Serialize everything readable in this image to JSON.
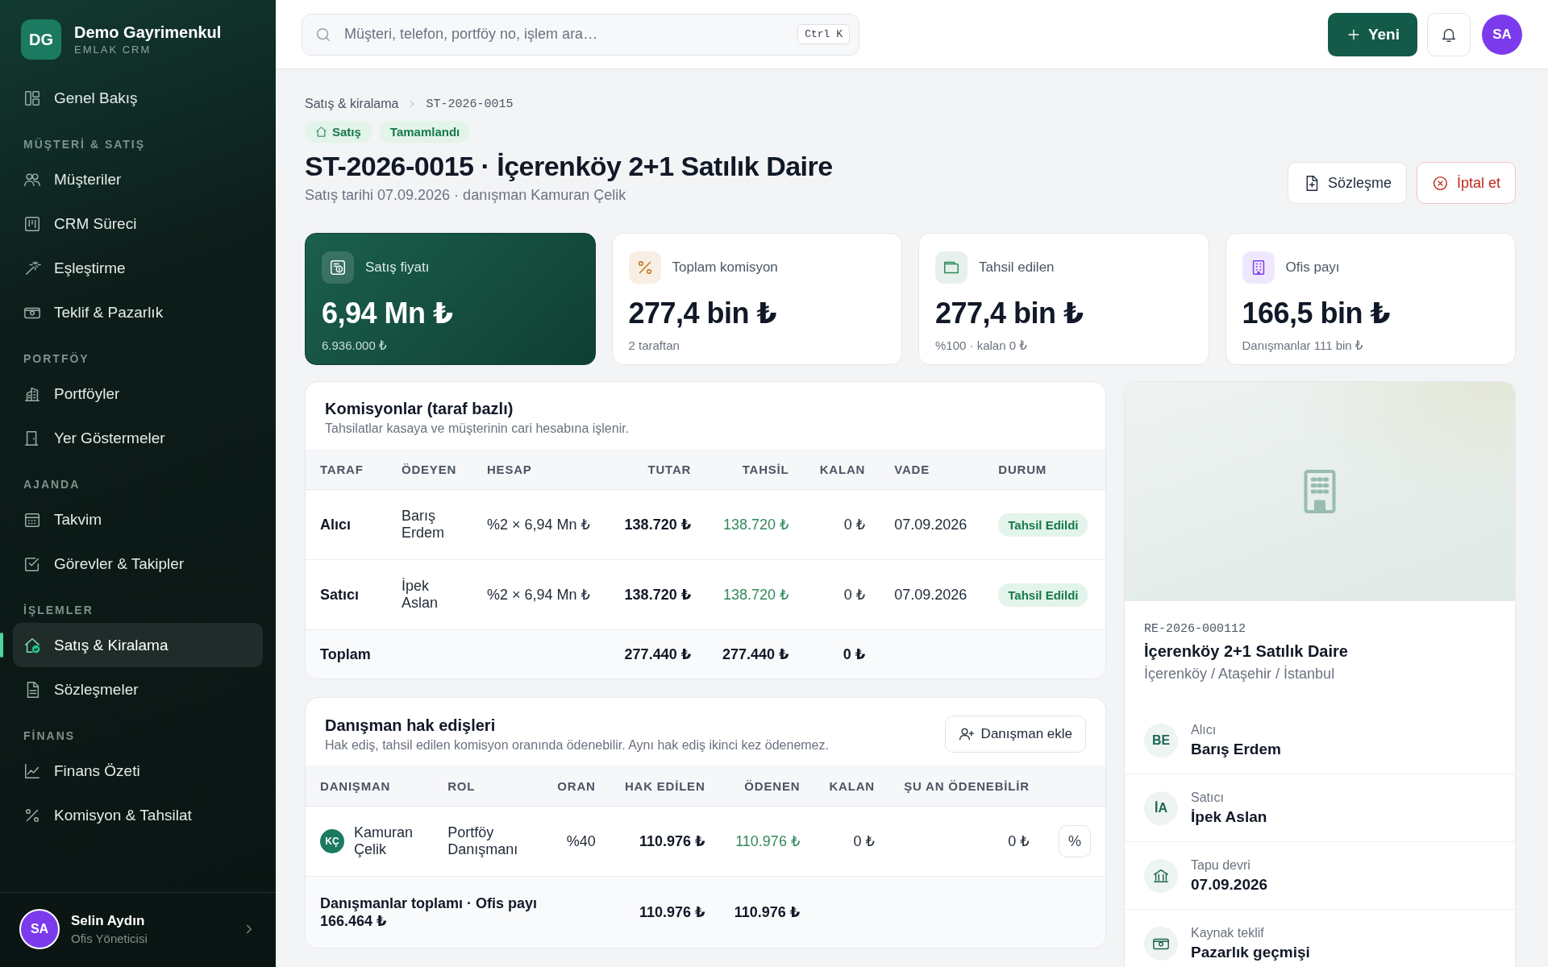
{
  "brand": {
    "logo": "DG",
    "name": "Demo Gayrimenkul",
    "tagline": "EMLAK CRM"
  },
  "sidebar": {
    "sections": [
      {
        "items": [
          {
            "label": "Genel Bakış",
            "selected": false
          }
        ]
      },
      {
        "title": "MÜŞTERİ & SATIŞ",
        "items": [
          {
            "label": "Müşteriler",
            "selected": false
          },
          {
            "label": "CRM Süreci",
            "selected": false
          },
          {
            "label": "Eşleştirme",
            "selected": false
          },
          {
            "label": "Teklif & Pazarlık",
            "selected": false
          }
        ]
      },
      {
        "title": "PORTFÖY",
        "items": [
          {
            "label": "Portföyler",
            "selected": false
          },
          {
            "label": "Yer Göstermeler",
            "selected": false
          }
        ]
      },
      {
        "title": "AJANDA",
        "items": [
          {
            "label": "Takvim",
            "selected": false
          },
          {
            "label": "Görevler & Takipler",
            "selected": false
          }
        ]
      },
      {
        "title": "İŞLEMLER",
        "items": [
          {
            "label": "Satış & Kiralama",
            "selected": true
          },
          {
            "label": "Sözleşmeler",
            "selected": false
          }
        ]
      },
      {
        "title": "FİNANS",
        "items": [
          {
            "label": "Finans Özeti",
            "selected": false
          },
          {
            "label": "Komisyon & Tahsilat",
            "selected": false
          }
        ]
      }
    ]
  },
  "user": {
    "initials": "SA",
    "name": "Selin Aydın",
    "role": "Ofis Yöneticisi"
  },
  "header": {
    "search": {
      "placeholder": "Müşteri, telefon, portföy no, işlem ara…",
      "shortcut": "Ctrl K"
    },
    "new_button": "Yeni",
    "avatar": "SA"
  },
  "breadcrumb": [
    "Satış & kiralama",
    "ST-2026-0015"
  ],
  "tags": [
    "Satış",
    "Tamamlandı"
  ],
  "title": "ST-2026-0015 · İçerenköy 2+1 Satılık Daire",
  "subtitle": "Satış tarihi 07.09.2026 · danışman Kamuran Çelik",
  "actions": [
    {
      "label": "Sözleşme",
      "kind": "default"
    },
    {
      "label": "İptal et",
      "kind": "danger"
    }
  ],
  "kpis": [
    {
      "kind": "featured",
      "label": "Satış fiyatı",
      "value": "6,94 Mn ₺",
      "note": "6.936.000 ₺",
      "color": "#ffffff"
    },
    {
      "kind": "plain",
      "label": "Toplam komisyon",
      "value": "277,4 bin ₺",
      "note": "2 taraftan",
      "color": "#c2721a"
    },
    {
      "kind": "plain",
      "label": "Tahsil edilen",
      "value": "277,4 bin ₺",
      "note": "%100 · kalan 0 ₺",
      "color": "#2f8a5a"
    },
    {
      "kind": "plain",
      "label": "Ofis payı",
      "value": "166,5 bin ₺",
      "note": "Danışmanlar 111 bin ₺",
      "color": "#7c3aed"
    }
  ],
  "commissions": {
    "title": "Komisyonlar (taraf bazlı)",
    "subtitle": "Tahsilatlar kasaya ve müşterinin cari hesabına işlenir.",
    "columns": [
      "TARAF",
      "ÖDEYEN",
      "HESAP",
      "TUTAR",
      "TAHSİL",
      "KALAN",
      "VADE",
      "DURUM"
    ],
    "rows": [
      {
        "party": "Alıcı",
        "payer": "Barış Erdem",
        "account": "%2 × 6,94 Mn ₺",
        "amount": "138.720 ₺",
        "collected": "138.720 ₺",
        "remaining": "0 ₺",
        "due": "07.09.2026",
        "status": "Tahsil Edildi"
      },
      {
        "party": "Satıcı",
        "payer": "İpek Aslan",
        "account": "%2 × 6,94 Mn ₺",
        "amount": "138.720 ₺",
        "collected": "138.720 ₺",
        "remaining": "0 ₺",
        "due": "07.09.2026",
        "status": "Tahsil Edildi"
      }
    ],
    "total": {
      "label": "Toplam",
      "amount": "277.440 ₺",
      "collected": "277.440 ₺",
      "remaining": "0 ₺"
    }
  },
  "advisors": {
    "title": "Danışman hak edişleri",
    "subtitle": "Hak ediş, tahsil edilen komisyon oranında ödenebilir. Aynı hak ediş ikinci kez ödenemez.",
    "add_button": "Danışman ekle",
    "columns": [
      "DANIŞMAN",
      "ROL",
      "ORAN",
      "HAK EDİLEN",
      "ÖDENEN",
      "KALAN",
      "ŞU AN ÖDENEBİLİR"
    ],
    "rows": [
      {
        "initials": "KÇ",
        "name": "Kamuran Çelik",
        "role": "Portföy Danışmanı",
        "rate": "%40",
        "earned": "110.976 ₺",
        "paid": "110.976 ₺",
        "remaining": "0 ₺",
        "payable": "0 ₺",
        "action": "%"
      }
    ],
    "total": {
      "label": "Danışmanlar toplamı · Ofis payı 166.464 ₺",
      "earned": "110.976 ₺",
      "paid": "110.976 ₺"
    }
  },
  "property": {
    "code": "RE-2026-000112",
    "title": "İçerenköy 2+1 Satılık Daire",
    "location": "İçerenköy / Ataşehir / İstanbul",
    "details": [
      {
        "kind": "person",
        "initials": "BE",
        "label": "Alıcı",
        "value": "Barış Erdem"
      },
      {
        "kind": "person",
        "initials": "İA",
        "label": "Satıcı",
        "value": "İpek Aslan"
      },
      {
        "kind": "bank",
        "label": "Tapu devri",
        "value": "07.09.2026"
      },
      {
        "kind": "money",
        "label": "Kaynak teklif",
        "value": "Pazarlık geçmişi"
      }
    ]
  }
}
